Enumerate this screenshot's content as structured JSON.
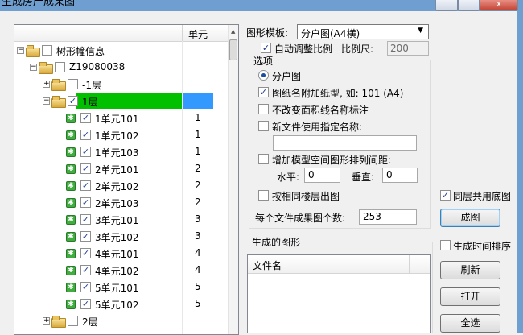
{
  "window": {
    "title": "生成房产成果图",
    "close_glyph": "x"
  },
  "tree": {
    "column_header": "单元",
    "rows": [
      {
        "label": "树形幢信息",
        "num": ""
      },
      {
        "label": "Z19080038",
        "num": ""
      },
      {
        "label": "-1层",
        "num": ""
      },
      {
        "label": "1层",
        "num": ""
      },
      {
        "label": "1单元101",
        "num": "1"
      },
      {
        "label": "1单元102",
        "num": "1"
      },
      {
        "label": "1单元103",
        "num": "1"
      },
      {
        "label": "2单元101",
        "num": "2"
      },
      {
        "label": "2单元102",
        "num": "2"
      },
      {
        "label": "2单元103",
        "num": "2"
      },
      {
        "label": "3单元101",
        "num": "3"
      },
      {
        "label": "3单元102",
        "num": "3"
      },
      {
        "label": "4单元101",
        "num": "4"
      },
      {
        "label": "4单元102",
        "num": "4"
      },
      {
        "label": "5单元101",
        "num": "5"
      },
      {
        "label": "5单元102",
        "num": "5"
      },
      {
        "label": "2层",
        "num": ""
      }
    ]
  },
  "template": {
    "label": "图形模板:",
    "value": "分户图(A4横)"
  },
  "auto_scale": {
    "label": "自动调整比例",
    "checked": true,
    "scale_label": "比例尺:",
    "scale_value": "200"
  },
  "options": {
    "title": "选项",
    "radio_label": "分户图",
    "attach_paper_label": "图纸名附加纸型, 如: 101 (A4)",
    "attach_paper_checked": true,
    "no_change_label": "不改变面积线名称标注",
    "no_change_checked": false,
    "custom_name_label": "新文件使用指定名称:",
    "custom_name_checked": false,
    "custom_name_value": "",
    "spacing_label": "增加模型空间图形排列间距:",
    "spacing_checked": false,
    "horizontal_label": "水平:",
    "horizontal_value": "0",
    "vertical_label": "垂直:",
    "vertical_value": "0",
    "same_floor_label": "按相同楼层出图",
    "same_floor_checked": false,
    "per_file_label": "每个文件成果图个数:",
    "per_file_value": "253"
  },
  "right_panel": {
    "shared_bg_label": "同层共用底图",
    "shared_bg_checked": true,
    "generate_label": "成图",
    "sort_time_label": "生成时间排序",
    "sort_time_checked": false,
    "refresh_label": "刷新",
    "open_label": "打开",
    "select_all_label": "全选"
  },
  "generated": {
    "title": "生成的图形",
    "column_header": "文件名"
  },
  "colors": {
    "selected_row": "#00c000",
    "selected_cell": "#3399ff"
  }
}
